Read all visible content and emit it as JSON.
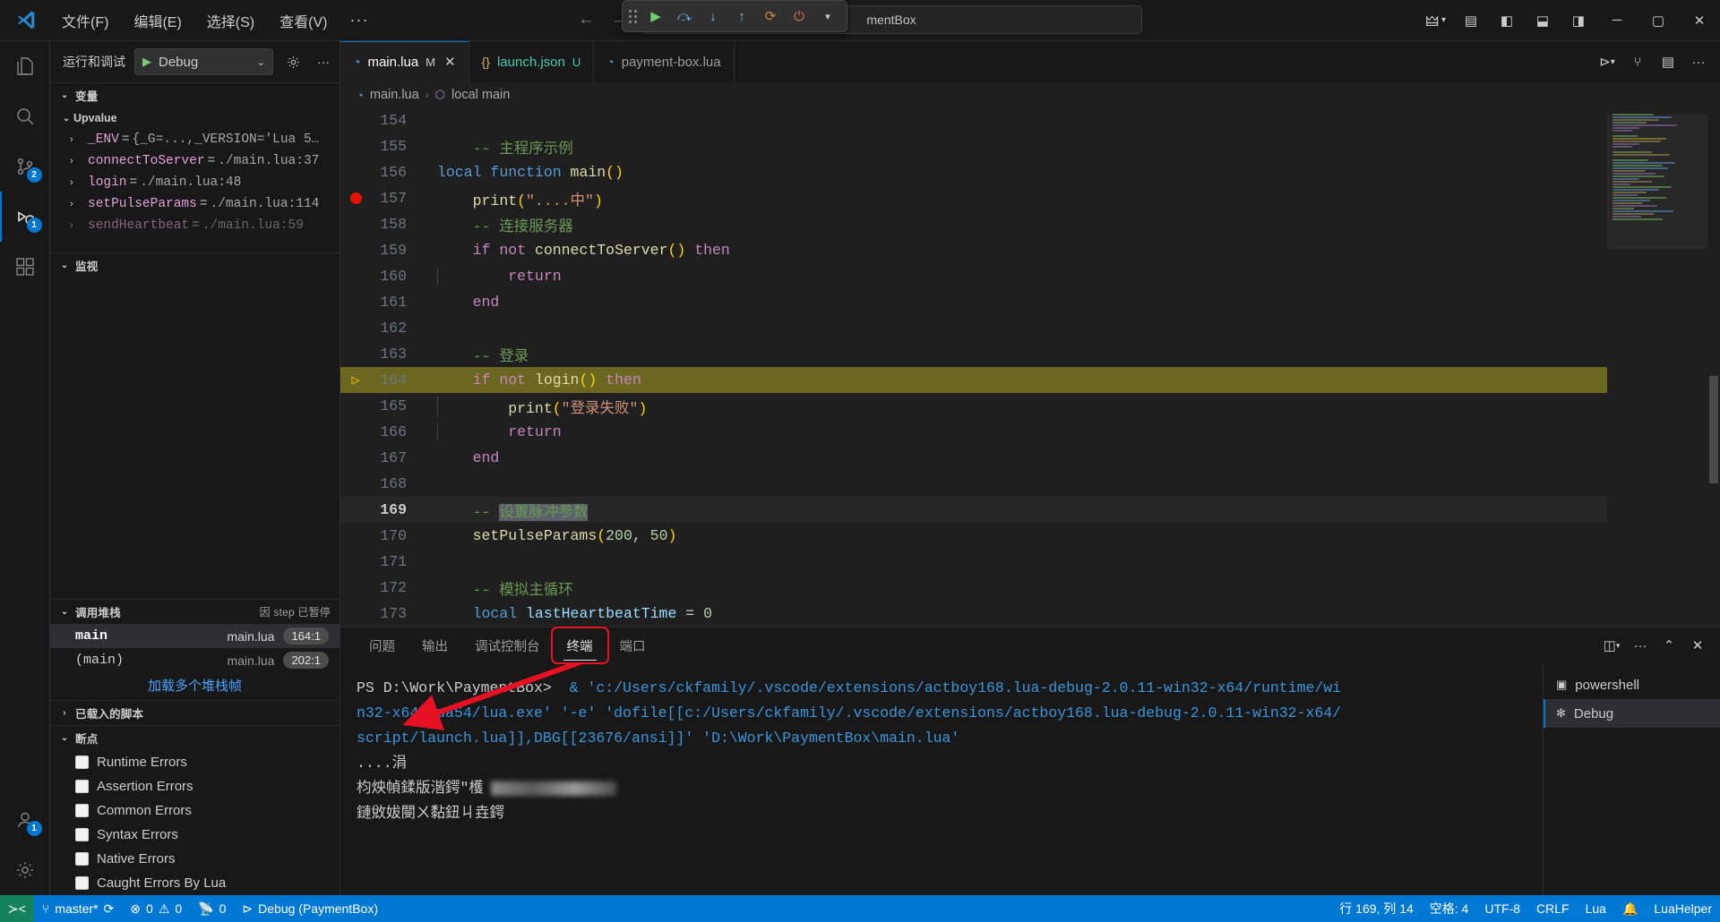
{
  "window": {
    "menu": [
      "文件(F)",
      "编辑(E)",
      "选择(S)",
      "查看(V)"
    ],
    "menu_overflow": "···",
    "search_placeholder": "mentBox",
    "nav_back": "←",
    "nav_forward": "→"
  },
  "debug_toolbar": {
    "continue": "continue-icon",
    "step_over": "step-over-icon",
    "step_into": "step-into-icon",
    "step_out": "step-out-icon",
    "restart": "restart-icon",
    "disconnect": "disconnect-icon",
    "dropdown": "chevron-down-icon"
  },
  "sidebar": {
    "title": "运行和调试",
    "launch_config": "Debug",
    "sections": {
      "variables": {
        "label": "变量",
        "group": "Upvalue",
        "rows": [
          {
            "name": "_ENV",
            "value": "{_G=...,_VERSION='Lua 5…"
          },
          {
            "name": "connectToServer",
            "value": "./main.lua:37"
          },
          {
            "name": "login",
            "value": "./main.lua:48"
          },
          {
            "name": "setPulseParams",
            "value": "./main.lua:114"
          },
          {
            "name": "sendHeartbeat",
            "value": "./main.lua:59"
          }
        ]
      },
      "watch": {
        "label": "监视"
      },
      "callstack": {
        "label": "调用堆栈",
        "note": "因 step 已暂停",
        "rows": [
          {
            "fn": "main",
            "file": "main.lua",
            "pos": "164:1",
            "selected": true
          },
          {
            "fn": "(main)",
            "file": "main.lua",
            "pos": "202:1",
            "selected": false
          }
        ],
        "load_more": "加载多个堆栈帧"
      },
      "loaded_scripts": {
        "label": "已载入的脚本"
      },
      "breakpoints": {
        "label": "断点",
        "items": [
          {
            "label": "Runtime Errors",
            "checked": false
          },
          {
            "label": "Assertion Errors",
            "checked": false
          },
          {
            "label": "Common Errors",
            "checked": false
          },
          {
            "label": "Syntax Errors",
            "checked": false
          },
          {
            "label": "Native Errors",
            "checked": false
          },
          {
            "label": "Caught Errors By Lua",
            "checked": false
          }
        ]
      }
    }
  },
  "editor": {
    "tabs": [
      {
        "label": "main.lua",
        "badge": "M",
        "active": true,
        "icon": "lua-icon",
        "closable": true
      },
      {
        "label": "launch.json",
        "badge": "U",
        "active": false,
        "icon": "json-icon",
        "closable": false
      },
      {
        "label": "payment-box.lua",
        "badge": "",
        "active": false,
        "icon": "lua-icon",
        "closable": false
      }
    ],
    "breadcrumb": [
      "main.lua",
      "local main"
    ],
    "lines": [
      {
        "n": "154",
        "text": ""
      },
      {
        "n": "155",
        "text": "-- 主程序示例"
      },
      {
        "n": "156",
        "text": "local function main()"
      },
      {
        "n": "157",
        "text": "print(\"....中\")",
        "breakpoint": true
      },
      {
        "n": "158",
        "text": "-- 连接服务器"
      },
      {
        "n": "159",
        "text": "if not connectToServer() then"
      },
      {
        "n": "160",
        "text": "return"
      },
      {
        "n": "161",
        "text": "end"
      },
      {
        "n": "162",
        "text": ""
      },
      {
        "n": "163",
        "text": "-- 登录"
      },
      {
        "n": "164",
        "text": "if not login() then",
        "current": true
      },
      {
        "n": "165",
        "text": "print(\"登录失败\")"
      },
      {
        "n": "166",
        "text": "return"
      },
      {
        "n": "167",
        "text": "end"
      },
      {
        "n": "168",
        "text": ""
      },
      {
        "n": "169",
        "text": "-- 设置脉冲参数",
        "cursor": true
      },
      {
        "n": "170",
        "text": "setPulseParams(200, 50)"
      },
      {
        "n": "171",
        "text": ""
      },
      {
        "n": "172",
        "text": "-- 模拟主循环"
      },
      {
        "n": "173",
        "text": "local lastHeartbeatTime = 0"
      }
    ]
  },
  "panel": {
    "tabs": [
      {
        "label": "问题",
        "active": false
      },
      {
        "label": "输出",
        "active": false
      },
      {
        "label": "调试控制台",
        "active": false
      },
      {
        "label": "终端",
        "active": true,
        "highlighted": true
      },
      {
        "label": "端口",
        "active": false
      }
    ],
    "terminal_lines": [
      "PS D:\\Work\\PaymentBox>  & 'c:/Users/ckfamily/.vscode/extensions/actboy168.lua-debug-2.0.11-win32-x64/runtime/wi",
      "n32-x64/lua54/lua.exe' '-e' 'dofile[[c:/Users/ckfamily/.vscode/extensions/actboy168.lua-debug-2.0.11-win32-x64/",
      "script/launch.lua]],DBG[[23676/ansi]]' 'D:\\Work\\PaymentBox\\main.lua'",
      "....涓",
      "枃炴幀鍒版湝鍔\"檴",
      "鏈敓妭閿ㄨ黏鈕ㄐ垚鍔"
    ],
    "terminal_tabs": [
      {
        "label": "powershell",
        "active": false,
        "icon": "terminal-icon"
      },
      {
        "label": "Debug",
        "active": true,
        "icon": "debug-terminal-icon"
      }
    ]
  },
  "statusbar": {
    "remote_icon": "remote-icon",
    "branch": "master*",
    "sync_icon": "sync-icon",
    "errors": "0",
    "warnings": "0",
    "ports": "0",
    "debug_session": "Debug (PaymentBox)",
    "cursor_position": "行 169, 列 14",
    "indent": "空格: 4",
    "encoding": "UTF-8",
    "eol": "CRLF",
    "language": "Lua",
    "bell_icon": "bell-icon",
    "extension": "LuaHelper"
  },
  "colors": {
    "accent": "#0078d4",
    "breakpoint": "#e51400",
    "highlight_line": "#6b6620",
    "annotation_red": "#e81123"
  }
}
